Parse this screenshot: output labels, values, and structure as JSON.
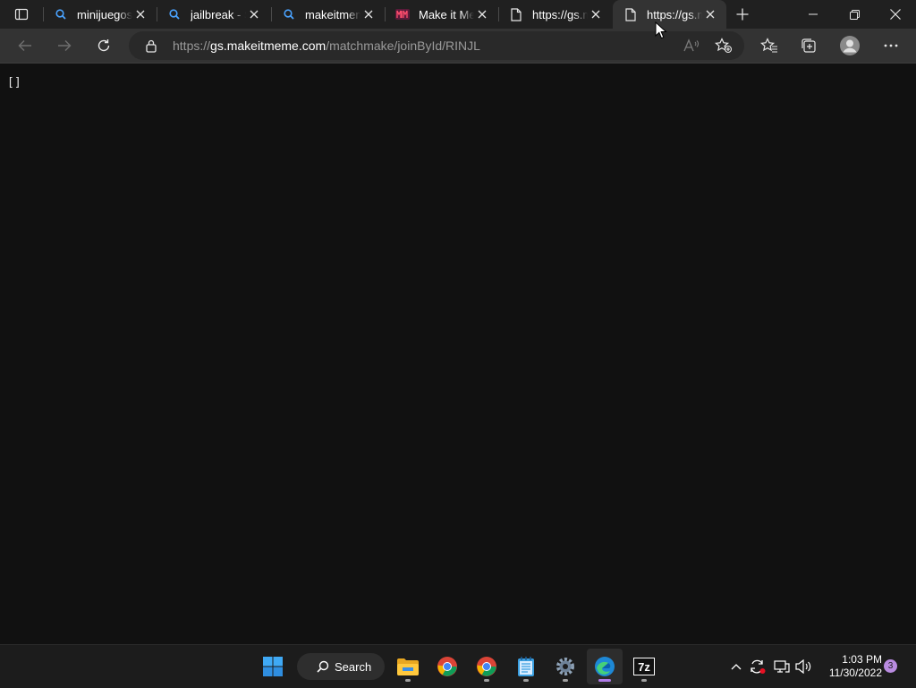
{
  "browser": {
    "tabs": [
      {
        "title": "minijuegos",
        "favicon": "search-icon",
        "active": false
      },
      {
        "title": "jailbreak - S",
        "favicon": "search-icon",
        "active": false
      },
      {
        "title": "makeitmem",
        "favicon": "search-icon",
        "active": false
      },
      {
        "title": "Make it Me",
        "favicon": "makeitmeme-logo-icon",
        "active": false
      },
      {
        "title": "https://gs.m",
        "favicon": "page-icon",
        "active": false
      },
      {
        "title": "https://gs.m",
        "favicon": "page-icon",
        "active": true
      }
    ],
    "address": {
      "prefix": "https://",
      "domain": "gs.makeitmeme.com",
      "path": "/matchmake/joinById/RINJL"
    }
  },
  "page": {
    "body_text": "[]"
  },
  "taskbar": {
    "search_label": "Search",
    "apps": [
      "windows-start-icon",
      "file-explorer-icon",
      "chrome-icon",
      "chrome-icon",
      "notepad-icon",
      "settings-icon",
      "edge-icon",
      "7zip-icon"
    ],
    "clock_time": "1:03 PM",
    "clock_date": "11/30/2022",
    "notification_count": "3"
  },
  "colors": {
    "background": "#111111",
    "tabstrip": "#202020",
    "toolbar": "#333333",
    "accent": "#b07be8",
    "search_favicon": "#4aa3ff"
  }
}
